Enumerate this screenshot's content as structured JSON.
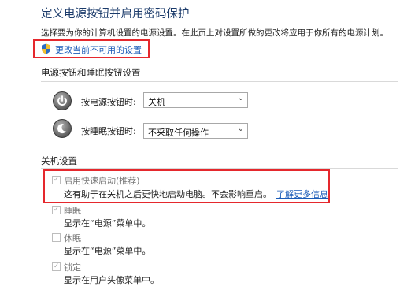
{
  "page": {
    "title": "定义电源按钮并启用密码保护",
    "description": "选择要为你的计算机设置的电源设置。在此页上对设置所做的更改将应用于你所有的电源计划。",
    "change_settings_link": "更改当前不可用的设置"
  },
  "power_buttons": {
    "section_title": "电源按钮和睡眠按钮设置",
    "power_button": {
      "label": "按电源按钮时:",
      "value": "关机"
    },
    "sleep_button": {
      "label": "按睡眠按钮时:",
      "value": "不采取任何操作"
    }
  },
  "shutdown": {
    "section_title": "关机设置",
    "items": [
      {
        "label": "启用快速启动(推荐)",
        "desc": "这有助于在关机之后更快地启动电脑。不会影响重启。",
        "link": "了解更多信息",
        "checked": true
      },
      {
        "label": "睡眠",
        "desc": "显示在“电源”菜单中。",
        "checked": true
      },
      {
        "label": "休眠",
        "desc": "显示在“电源”菜单中。",
        "checked": false
      },
      {
        "label": "锁定",
        "desc": "显示在用户头像菜单中。",
        "checked": true
      }
    ]
  },
  "colors": {
    "highlight_border": "#e5282d",
    "link": "#1a5bb8",
    "title": "#1a3a6a"
  }
}
